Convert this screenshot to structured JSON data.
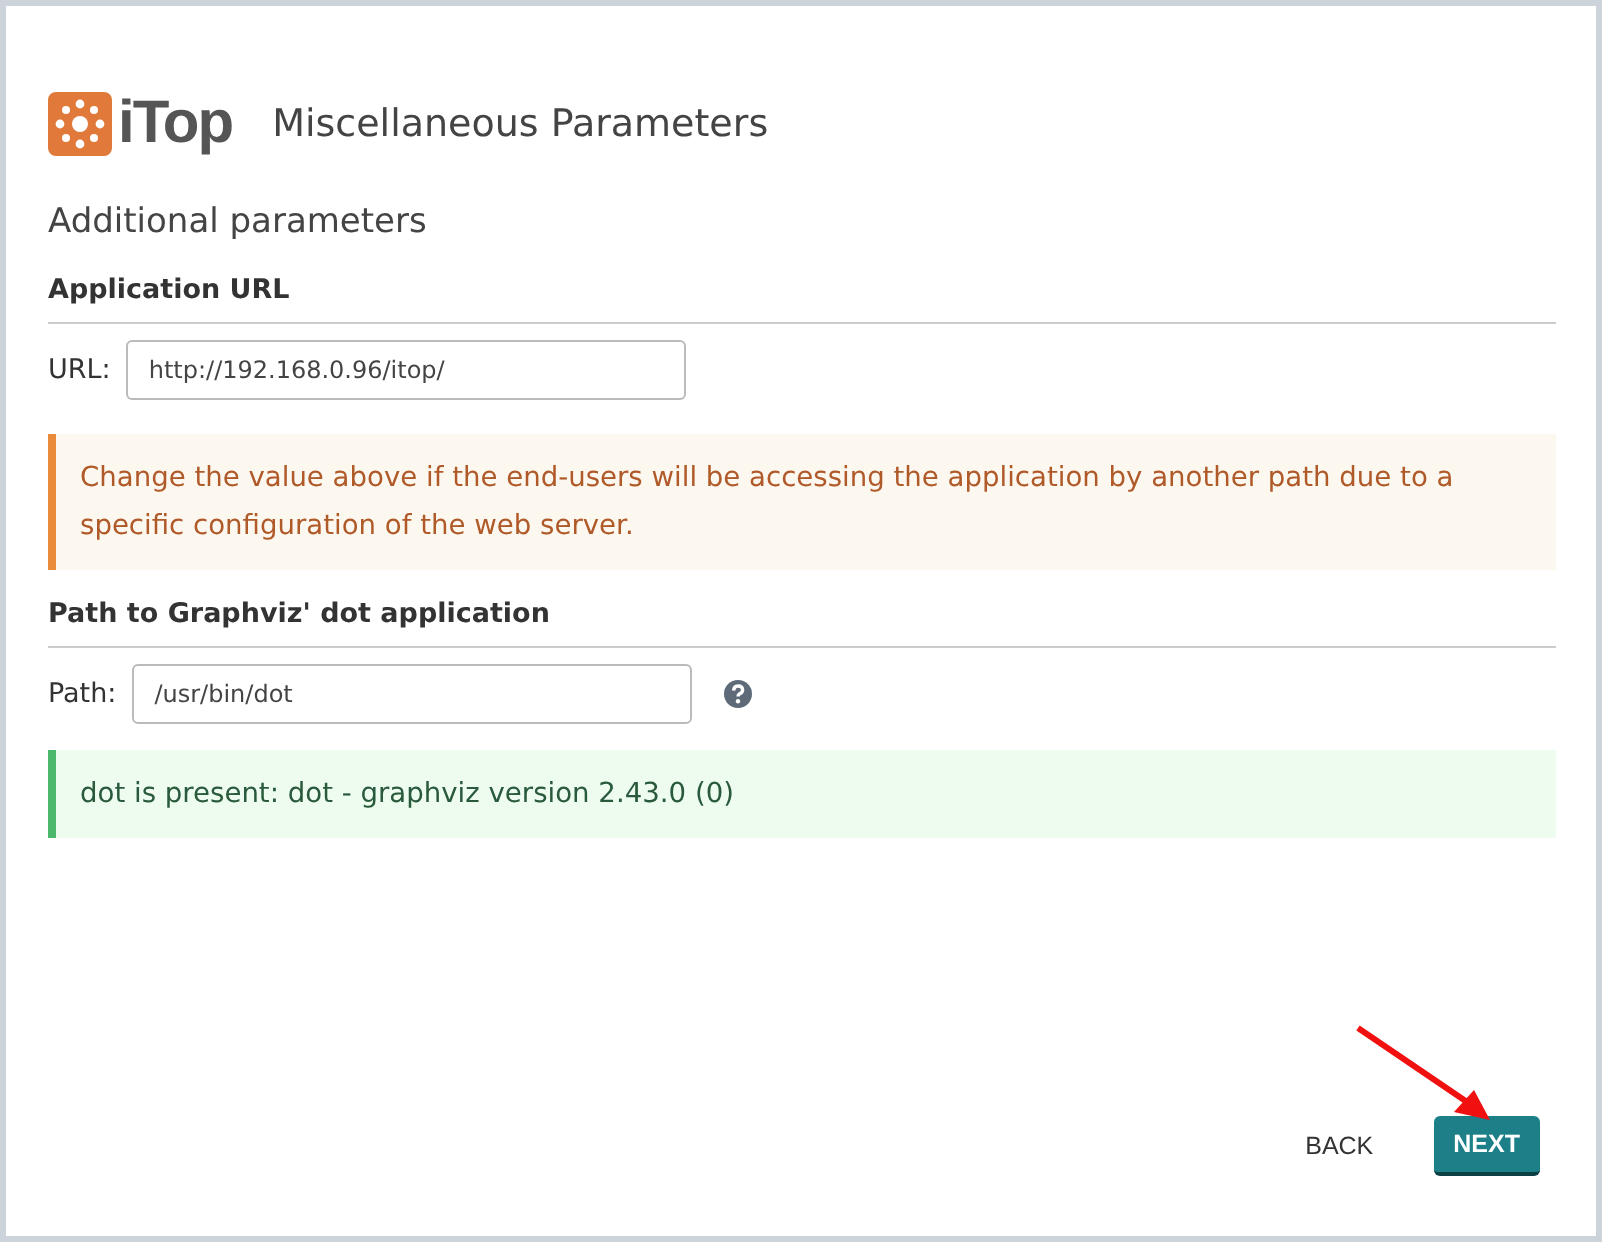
{
  "header": {
    "logo_text": "iTop",
    "title": "Miscellaneous Parameters"
  },
  "subtitle": "Additional parameters",
  "sections": [
    {
      "heading": "Application URL",
      "field": {
        "label": "URL:",
        "value": "http://192.168.0.96/itop/"
      },
      "help": false,
      "message": {
        "kind": "warning",
        "text": "Change the value above if the end-users will be accessing the application by another path due to a specific configuration of the web server."
      }
    },
    {
      "heading": "Path to Graphviz' dot application",
      "field": {
        "label": "Path:",
        "value": "/usr/bin/dot"
      },
      "help": true,
      "message": {
        "kind": "success",
        "text": "dot is present: dot - graphviz version 2.43.0 (0)"
      }
    }
  ],
  "buttons": [
    {
      "label": "BACK",
      "kind": "link"
    },
    {
      "label": "NEXT",
      "kind": "primary"
    }
  ]
}
